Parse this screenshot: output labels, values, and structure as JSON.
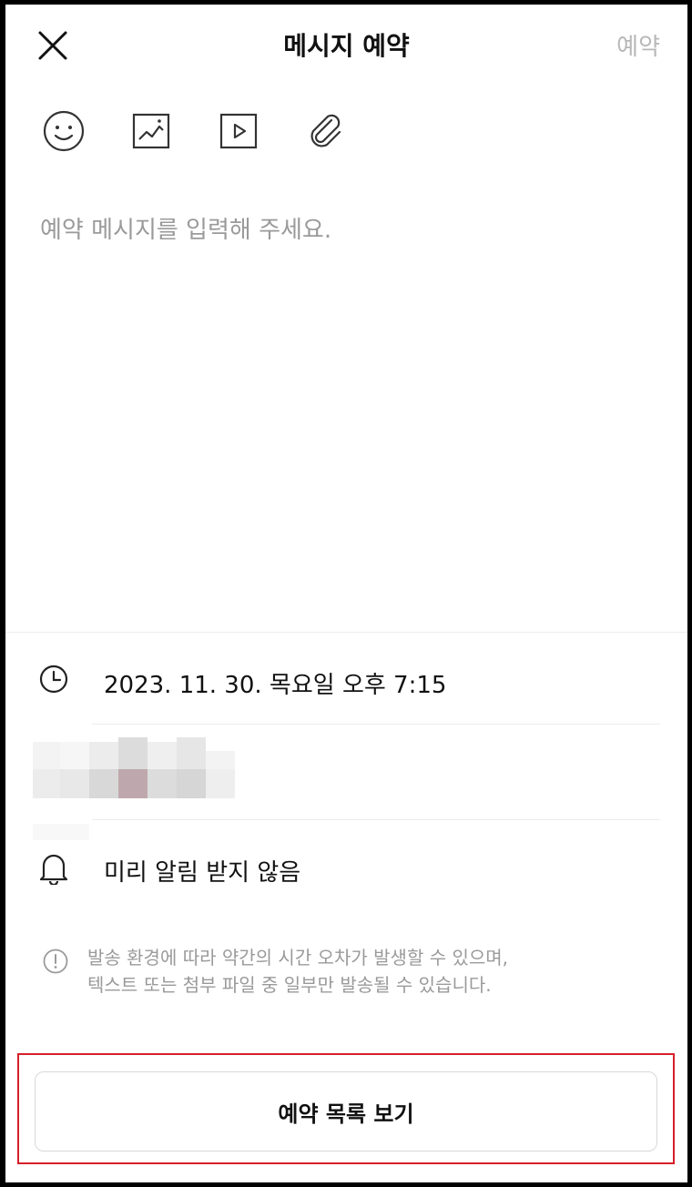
{
  "header": {
    "title": "메시지 예약",
    "reserve_label": "예약"
  },
  "toolbar": {
    "icons": [
      "smile-icon",
      "image-icon",
      "video-icon",
      "attachment-icon"
    ]
  },
  "message": {
    "placeholder": "예약 메시지를 입력해 주세요."
  },
  "schedule": {
    "datetime": "2023. 11. 30. 목요일 오후 7:15"
  },
  "alarm": {
    "label": "미리 알림 받지 않음"
  },
  "notice": {
    "text": "발송 환경에 따라 약간의 시간 오차가 발생할 수 있으며,\n텍스트 또는 첨부 파일 중 일부만 발송될 수 있습니다."
  },
  "footer": {
    "list_button_label": "예약 목록 보기"
  },
  "colors": {
    "highlight": "#d6202a",
    "muted": "#9a9a9a"
  }
}
